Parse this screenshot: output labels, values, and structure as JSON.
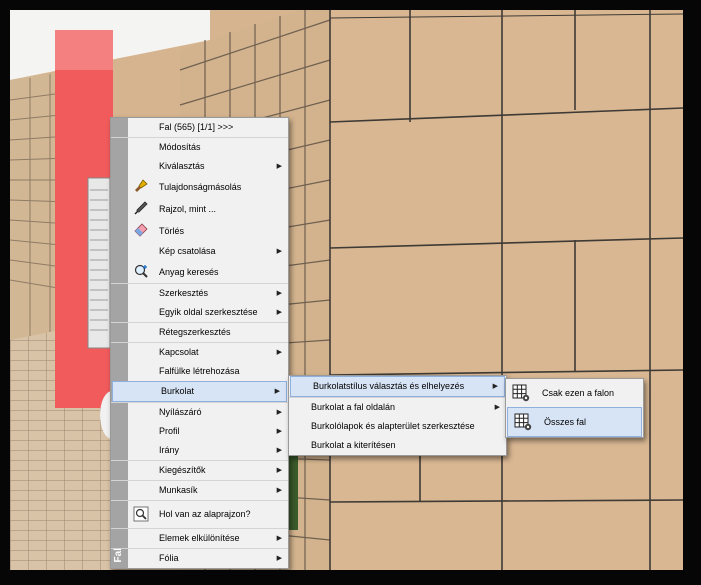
{
  "context_menu": {
    "side_label": "Fal",
    "items": [
      {
        "label": "Fal (565) [1/1] >>>",
        "icon": "",
        "submenu": false
      },
      {
        "label": "Módosítás",
        "icon": "",
        "submenu": false
      },
      {
        "label": "Kiválasztás",
        "icon": "",
        "submenu": true
      },
      {
        "label": "Tulajdonságmásolás",
        "icon": "brush-icon",
        "submenu": false
      },
      {
        "label": "Rajzol, mint ...",
        "icon": "eyedropper-icon",
        "submenu": false
      },
      {
        "label": "Törlés",
        "icon": "eraser-icon",
        "submenu": false
      },
      {
        "label": "Kép csatolása",
        "icon": "",
        "submenu": true
      },
      {
        "label": "Anyag keresés",
        "icon": "magnifier-icon",
        "submenu": false
      },
      {
        "label": "Szerkesztés",
        "icon": "",
        "submenu": true
      },
      {
        "label": "Egyik oldal szerkesztése",
        "icon": "",
        "submenu": true
      },
      {
        "label": "Rétegszerkesztés",
        "icon": "",
        "submenu": false
      },
      {
        "label": "Kapcsolat",
        "icon": "",
        "submenu": true
      },
      {
        "label": "Falfülke létrehozása",
        "icon": "",
        "submenu": false
      },
      {
        "label": "Burkolat",
        "icon": "",
        "submenu": true
      },
      {
        "label": "Nyílászáró",
        "icon": "",
        "submenu": true
      },
      {
        "label": "Profil",
        "icon": "",
        "submenu": true
      },
      {
        "label": "Irány",
        "icon": "",
        "submenu": true
      },
      {
        "label": "Kiegészítők",
        "icon": "",
        "submenu": true
      },
      {
        "label": "Munkasík",
        "icon": "",
        "submenu": true
      },
      {
        "label": "Hol van az alaprajzon?",
        "icon": "find-on-plan-icon",
        "submenu": false
      },
      {
        "label": "Elemek elkülönítése",
        "icon": "",
        "submenu": true
      },
      {
        "label": "Fólia",
        "icon": "",
        "submenu": true
      }
    ]
  },
  "burkolat_submenu": {
    "items": [
      {
        "label": "Burkolatstílus választás és elhelyezés",
        "submenu": true
      },
      {
        "label": "Burkolat a fal oldalán",
        "submenu": true
      },
      {
        "label": "Burkolólapok és alapterület szerkesztése",
        "submenu": false
      },
      {
        "label": "Burkolat a kiterítésen",
        "submenu": false
      }
    ]
  },
  "stilus_submenu": {
    "items": [
      {
        "label": "Csak ezen a falon",
        "icon": "tile-grid-icon"
      },
      {
        "label": "Összes fal",
        "icon": "tile-grid-icon"
      }
    ]
  },
  "colors": {
    "tile": "#d8b692",
    "grout": "#6e5e4e",
    "red_wall": "#f05a5a",
    "highlight": "#d7e4f6"
  }
}
